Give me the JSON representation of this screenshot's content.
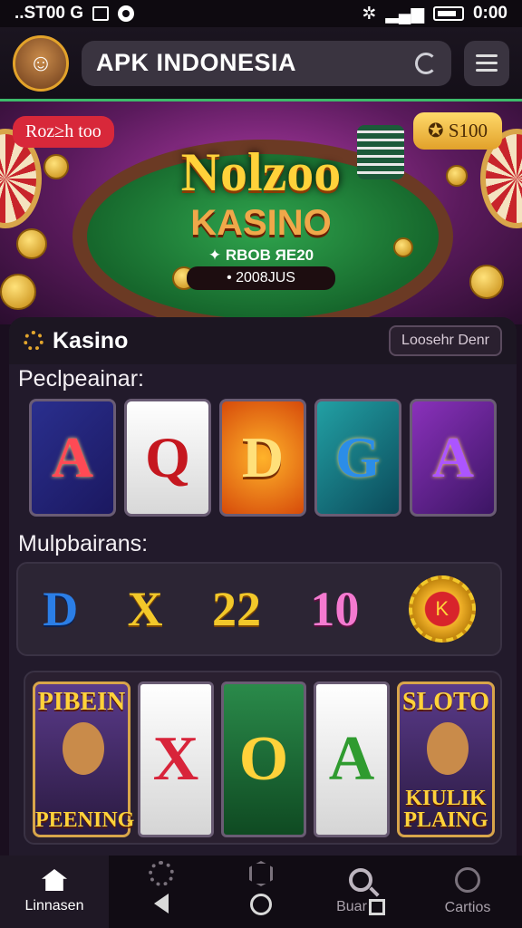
{
  "status": {
    "left_text": "..ST00 G",
    "right_text": "0:00"
  },
  "header": {
    "app_title": "APK INDONESIA"
  },
  "banner": {
    "tag_left": "Roz≥h too",
    "tag_right": "✪ S100",
    "title": "Nolzoo",
    "subtitle": "KASINO",
    "line1": "✦ RBOB ЯE20",
    "line2": "• 2008JUS"
  },
  "panel": {
    "title": "Kasino",
    "button_label": "Loosehr Denr",
    "section1_label": "Peclpeainar:",
    "section1_tiles": [
      "A",
      "Q",
      "D",
      "G",
      "A"
    ],
    "section2_label": "Mulpbairans:",
    "multipliers": [
      "D",
      "X",
      "22",
      "10"
    ],
    "multiplier_badge": "K",
    "slot_left": {
      "top": "PIBEIN",
      "bottom": "PEENING"
    },
    "reels": [
      "X",
      "O",
      "A"
    ],
    "slot_right": {
      "top": "SLOTO",
      "bottom": "KIULIK PLAING"
    }
  },
  "nav": {
    "home_label": "Linnasen",
    "buar_label": "Buar",
    "cartios_label": "Cartios"
  }
}
